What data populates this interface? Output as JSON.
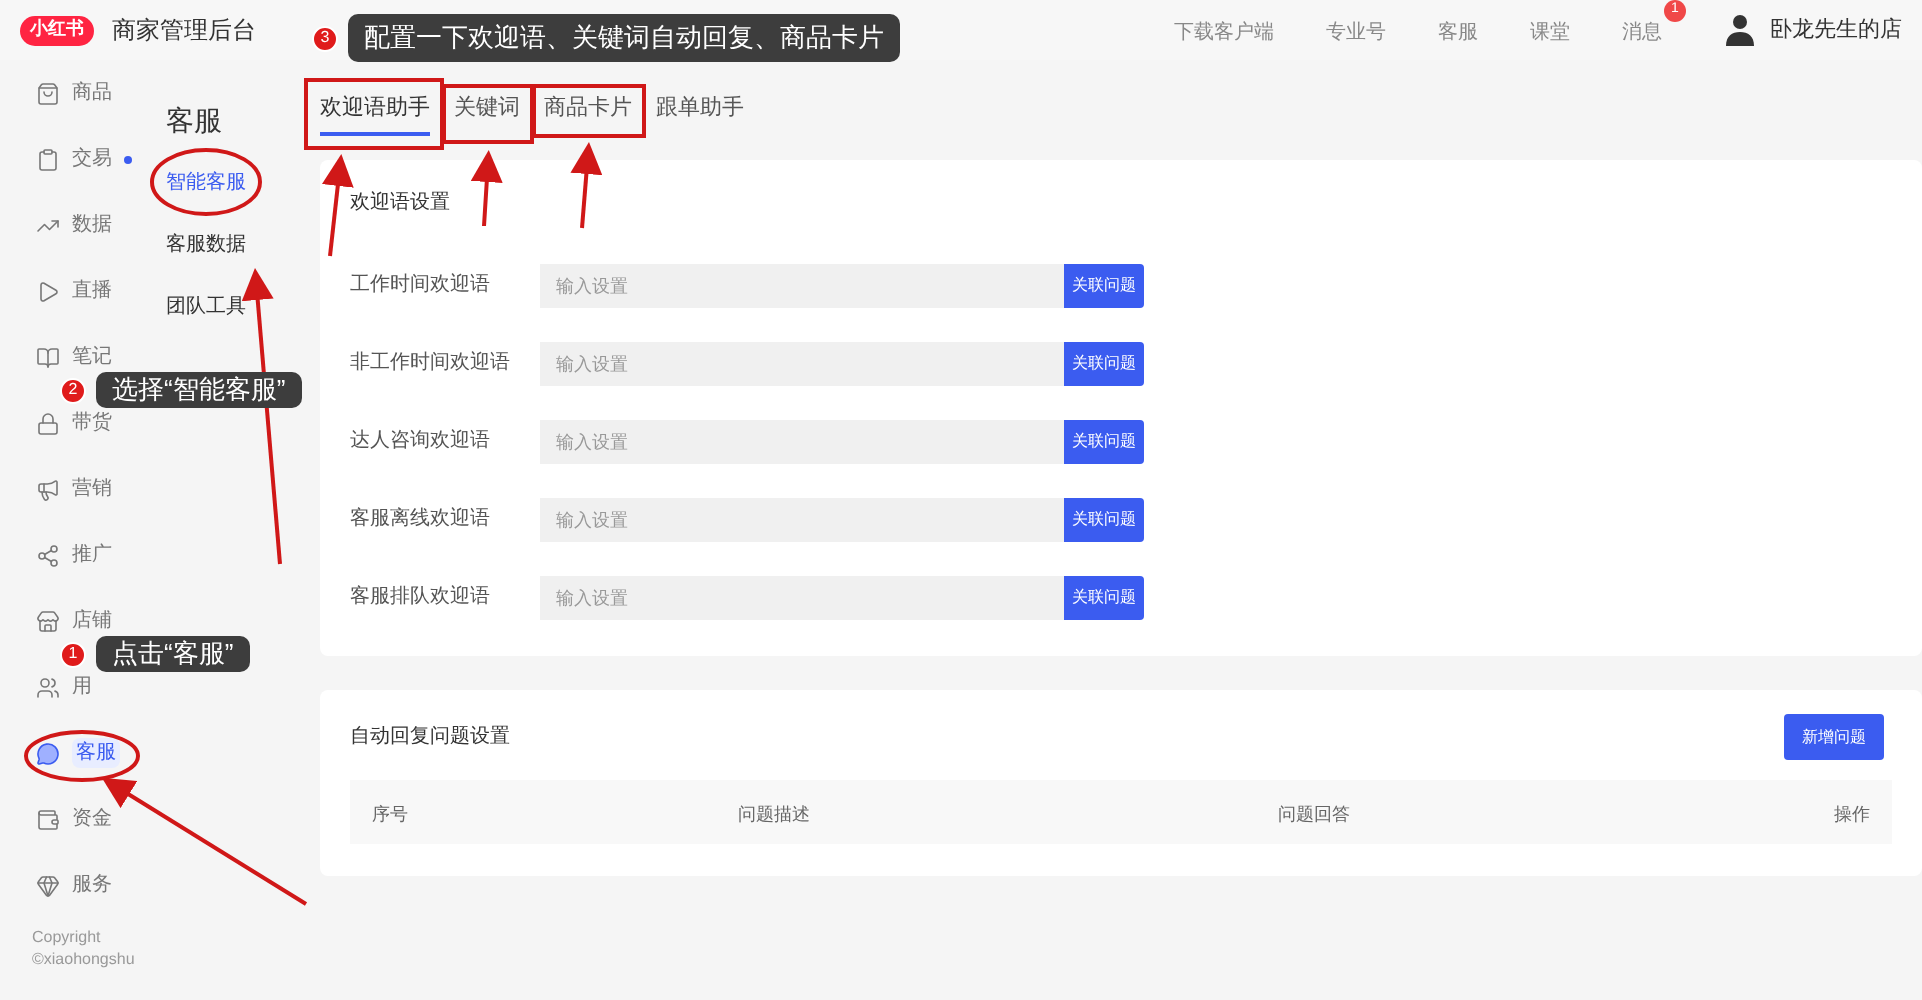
{
  "header": {
    "logo": "小红书",
    "title": "商家管理后台",
    "links": [
      {
        "label": "下载客户端"
      },
      {
        "label": "专业号"
      },
      {
        "label": "客服"
      },
      {
        "label": "课堂"
      },
      {
        "label": "消息",
        "badge": "1"
      }
    ],
    "shop_name": "卧龙先生的店"
  },
  "sidebar": {
    "items": [
      {
        "label": "商品",
        "selected": false,
        "dot": false
      },
      {
        "label": "交易",
        "selected": false,
        "dot": true
      },
      {
        "label": "数据",
        "selected": false,
        "dot": false
      },
      {
        "label": "直播",
        "selected": false,
        "dot": false
      },
      {
        "label": "笔记",
        "selected": false,
        "dot": false
      },
      {
        "label": "带货",
        "selected": false,
        "dot": false
      },
      {
        "label": "营销",
        "selected": false,
        "dot": false
      },
      {
        "label": "推广",
        "selected": false,
        "dot": false
      },
      {
        "label": "店铺",
        "selected": false,
        "dot": false
      },
      {
        "label": "用",
        "selected": false,
        "dot": false
      },
      {
        "label": "客服",
        "selected": true,
        "dot": false
      },
      {
        "label": "资金",
        "selected": false,
        "dot": false
      },
      {
        "label": "服务",
        "selected": false,
        "dot": false
      }
    ],
    "copyright": [
      "Copyright",
      "©xiaohongshu"
    ]
  },
  "submenu": {
    "title": "客服",
    "items": [
      {
        "label": "智能客服",
        "selected": true
      },
      {
        "label": "客服数据",
        "selected": false
      },
      {
        "label": "团队工具",
        "selected": false
      }
    ]
  },
  "tabs": [
    {
      "label": "欢迎语助手",
      "selected": true
    },
    {
      "label": "关键词",
      "selected": false
    },
    {
      "label": "商品卡片",
      "selected": false
    },
    {
      "label": "跟单助手",
      "selected": false
    }
  ],
  "welcome": {
    "title": "欢迎语设置",
    "rows": [
      {
        "label": "工作时间欢迎语",
        "placeholder": "输入设置",
        "button": "关联问题"
      },
      {
        "label": "非工作时间欢迎语",
        "placeholder": "输入设置",
        "button": "关联问题"
      },
      {
        "label": "达人咨询欢迎语",
        "placeholder": "输入设置",
        "button": "关联问题"
      },
      {
        "label": "客服离线欢迎语",
        "placeholder": "输入设置",
        "button": "关联问题"
      },
      {
        "label": "客服排队欢迎语",
        "placeholder": "输入设置",
        "button": "关联问题"
      }
    ]
  },
  "auto_reply": {
    "title": "自动回复问题设置",
    "add_button": "新增问题",
    "columns": [
      "序号",
      "问题描述",
      "问题回答",
      "操作"
    ]
  },
  "callouts": [
    {
      "number": "3",
      "text": "配置一下欢迎语、关键词自动回复、商品卡片"
    },
    {
      "number": "2",
      "text": "选择“智能客服”"
    },
    {
      "number": "1",
      "text": "点击“客服”"
    }
  ]
}
